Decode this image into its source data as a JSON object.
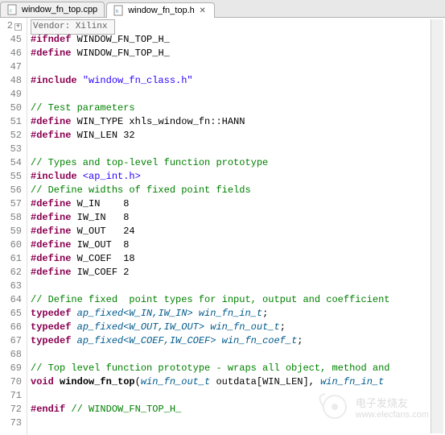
{
  "tabs": [
    {
      "label": "window_fn_top.cpp",
      "active": false
    },
    {
      "label": "window_fn_top.h",
      "active": true
    }
  ],
  "gutter_first": "2",
  "lines": [
    {
      "n": "",
      "segs": [
        {
          "cls": "folded-region",
          "t": "Vendor: Xilinx "
        }
      ]
    },
    {
      "n": "45",
      "segs": [
        {
          "cls": "kw-pp",
          "t": "#ifndef"
        },
        {
          "cls": "text",
          "t": " WINDOW_FN_TOP_H_"
        }
      ]
    },
    {
      "n": "46",
      "segs": [
        {
          "cls": "kw-pp",
          "t": "#define"
        },
        {
          "cls": "text",
          "t": " WINDOW_FN_TOP_H_"
        }
      ]
    },
    {
      "n": "47",
      "segs": []
    },
    {
      "n": "48",
      "segs": [
        {
          "cls": "kw-pp",
          "t": "#include"
        },
        {
          "cls": "text",
          "t": " "
        },
        {
          "cls": "string",
          "t": "\"window_fn_class.h\""
        }
      ]
    },
    {
      "n": "49",
      "segs": []
    },
    {
      "n": "50",
      "segs": [
        {
          "cls": "comment",
          "t": "// Test parameters"
        }
      ]
    },
    {
      "n": "51",
      "segs": [
        {
          "cls": "kw-pp",
          "t": "#define"
        },
        {
          "cls": "text",
          "t": " WIN_TYPE xhls_window_fn::HANN"
        }
      ]
    },
    {
      "n": "52",
      "segs": [
        {
          "cls": "kw-pp",
          "t": "#define"
        },
        {
          "cls": "text",
          "t": " WIN_LEN 32"
        }
      ]
    },
    {
      "n": "53",
      "segs": []
    },
    {
      "n": "54",
      "segs": [
        {
          "cls": "comment",
          "t": "// Types and top-level function prototype"
        }
      ]
    },
    {
      "n": "55",
      "segs": [
        {
          "cls": "kw-pp",
          "t": "#include"
        },
        {
          "cls": "text",
          "t": " "
        },
        {
          "cls": "sysinc",
          "t": "<ap_int.h>"
        }
      ]
    },
    {
      "n": "56",
      "segs": [
        {
          "cls": "comment",
          "t": "// Define widths of fixed point fields"
        }
      ]
    },
    {
      "n": "57",
      "segs": [
        {
          "cls": "kw-pp",
          "t": "#define"
        },
        {
          "cls": "text",
          "t": " W_IN    8"
        }
      ]
    },
    {
      "n": "58",
      "segs": [
        {
          "cls": "kw-pp",
          "t": "#define"
        },
        {
          "cls": "text",
          "t": " IW_IN   8"
        }
      ]
    },
    {
      "n": "59",
      "segs": [
        {
          "cls": "kw-pp",
          "t": "#define"
        },
        {
          "cls": "text",
          "t": " W_OUT   24"
        }
      ]
    },
    {
      "n": "60",
      "segs": [
        {
          "cls": "kw-pp",
          "t": "#define"
        },
        {
          "cls": "text",
          "t": " IW_OUT  8"
        }
      ]
    },
    {
      "n": "61",
      "segs": [
        {
          "cls": "kw-pp",
          "t": "#define"
        },
        {
          "cls": "text",
          "t": " W_COEF  18"
        }
      ]
    },
    {
      "n": "62",
      "segs": [
        {
          "cls": "kw-pp",
          "t": "#define"
        },
        {
          "cls": "text",
          "t": " IW_COEF 2"
        }
      ]
    },
    {
      "n": "63",
      "segs": []
    },
    {
      "n": "64",
      "segs": [
        {
          "cls": "comment",
          "t": "// Define fixed  point types for input, output and coefficient"
        }
      ]
    },
    {
      "n": "65",
      "segs": [
        {
          "cls": "kw-type",
          "t": "typedef"
        },
        {
          "cls": "text",
          "t": " "
        },
        {
          "cls": "typedefed",
          "t": "ap_fixed<W_IN,IW_IN>"
        },
        {
          "cls": "text",
          "t": " "
        },
        {
          "cls": "typedefed",
          "t": "win_fn_in_t"
        },
        {
          "cls": "text",
          "t": ";"
        }
      ]
    },
    {
      "n": "66",
      "segs": [
        {
          "cls": "kw-type",
          "t": "typedef"
        },
        {
          "cls": "text",
          "t": " "
        },
        {
          "cls": "typedefed",
          "t": "ap_fixed<W_OUT,IW_OUT>"
        },
        {
          "cls": "text",
          "t": " "
        },
        {
          "cls": "typedefed",
          "t": "win_fn_out_t"
        },
        {
          "cls": "text",
          "t": ";"
        }
      ]
    },
    {
      "n": "67",
      "segs": [
        {
          "cls": "kw-type",
          "t": "typedef"
        },
        {
          "cls": "text",
          "t": " "
        },
        {
          "cls": "typedefed",
          "t": "ap_fixed<W_COEF,IW_COEF>"
        },
        {
          "cls": "text",
          "t": " "
        },
        {
          "cls": "typedefed",
          "t": "win_fn_coef_t"
        },
        {
          "cls": "text",
          "t": ";"
        }
      ]
    },
    {
      "n": "68",
      "segs": []
    },
    {
      "n": "69",
      "segs": [
        {
          "cls": "comment",
          "t": "// Top level function prototype - wraps all object, method and "
        }
      ]
    },
    {
      "n": "70",
      "segs": [
        {
          "cls": "kw-type",
          "t": "void"
        },
        {
          "cls": "text",
          "t": " "
        },
        {
          "cls": "func",
          "t": "window_fn_top"
        },
        {
          "cls": "text",
          "t": "("
        },
        {
          "cls": "typedefed",
          "t": "win_fn_out_t"
        },
        {
          "cls": "text",
          "t": " outdata[WIN_LEN], "
        },
        {
          "cls": "typedefed",
          "t": "win_fn_in_t"
        },
        {
          "cls": "text",
          "t": " "
        }
      ]
    },
    {
      "n": "71",
      "segs": []
    },
    {
      "n": "72",
      "segs": [
        {
          "cls": "kw-pp",
          "t": "#endif"
        },
        {
          "cls": "text",
          "t": " "
        },
        {
          "cls": "comment",
          "t": "// WINDOW_FN_TOP_H_"
        }
      ]
    },
    {
      "n": "73",
      "segs": []
    }
  ],
  "watermark": {
    "text1": "电子发烧友",
    "text2": "www.elecfans.com"
  }
}
